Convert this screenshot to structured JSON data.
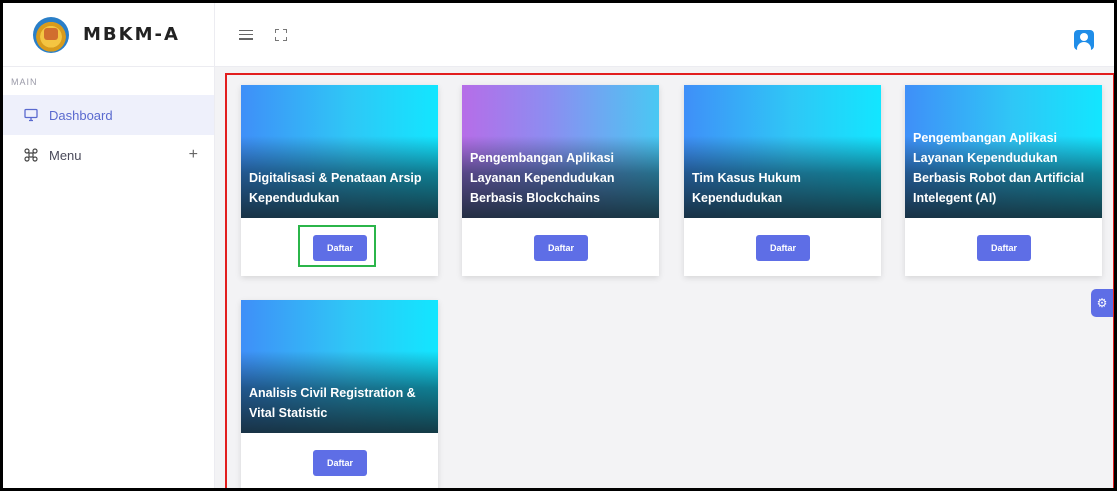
{
  "brand": {
    "name": "MBKM-A"
  },
  "sidebar": {
    "section_label": "MAIN",
    "items": [
      {
        "label": "Dashboard",
        "icon": "monitor-icon",
        "active": true
      },
      {
        "label": "Menu",
        "icon": "command-icon",
        "expand": "+"
      }
    ]
  },
  "topbar": {
    "icons": [
      "hamburger-icon",
      "fullscreen-icon",
      "user-avatar-icon"
    ]
  },
  "cards": [
    {
      "title": "Digitalisasi & Penataan Arsip Kependudukan",
      "button": "Daftar",
      "highlighted": true
    },
    {
      "title": "Pengembangan Aplikasi Layanan Kependudukan Berbasis Blockchains",
      "button": "Daftar"
    },
    {
      "title": "Tim Kasus Hukum Kependudukan",
      "button": "Daftar"
    },
    {
      "title": "Pengembangan Aplikasi Layanan Kependudukan Berbasis Robot dan Artificial Intelegent (AI)",
      "button": "Daftar"
    },
    {
      "title": "Analisis Civil Registration & Vital Statistic",
      "button": "Daftar"
    }
  ],
  "colors": {
    "accent": "#5e6ee6",
    "highlight_box": "#e21e1e",
    "focus_box": "#2bb54a"
  }
}
